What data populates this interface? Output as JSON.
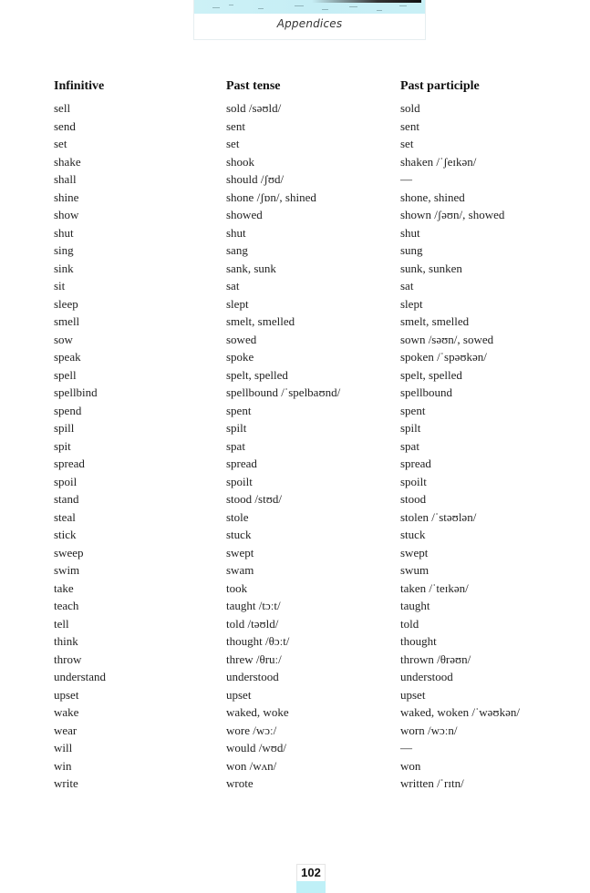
{
  "header": {
    "section_title": "Appendices"
  },
  "table": {
    "columns": [
      "Infinitive",
      "Past tense",
      "Past participle"
    ],
    "rows": [
      [
        "sell",
        "sold /səʊld/",
        "sold"
      ],
      [
        "send",
        "sent",
        "sent"
      ],
      [
        "set",
        "set",
        "set"
      ],
      [
        "shake",
        "shook",
        "shaken /ˈʃeɪkən/"
      ],
      [
        "shall",
        "should /ʃʊd/",
        "—"
      ],
      [
        "shine",
        "shone /ʃɒn/, shined",
        "shone, shined"
      ],
      [
        "show",
        "showed",
        "shown /ʃəʊn/, showed"
      ],
      [
        "shut",
        "shut",
        "shut"
      ],
      [
        "sing",
        "sang",
        "sung"
      ],
      [
        "sink",
        "sank, sunk",
        "sunk, sunken"
      ],
      [
        "sit",
        "sat",
        "sat"
      ],
      [
        "sleep",
        "slept",
        "slept"
      ],
      [
        "smell",
        "smelt, smelled",
        "smelt, smelled"
      ],
      [
        "sow",
        "sowed",
        "sown /səʊn/, sowed"
      ],
      [
        "speak",
        "spoke",
        "spoken /ˈspəʊkən/"
      ],
      [
        "spell",
        "spelt, spelled",
        "spelt, spelled"
      ],
      [
        "spellbind",
        "spellbound /ˈspelbaʊnd/",
        "spellbound"
      ],
      [
        "spend",
        "spent",
        "spent"
      ],
      [
        "spill",
        "spilt",
        "spilt"
      ],
      [
        "spit",
        "spat",
        "spat"
      ],
      [
        "spread",
        "spread",
        "spread"
      ],
      [
        "spoil",
        "spoilt",
        "spoilt"
      ],
      [
        "stand",
        "stood /stʊd/",
        "stood"
      ],
      [
        "steal",
        "stole",
        "stolen /ˈstəʊlən/"
      ],
      [
        "stick",
        "stuck",
        "stuck"
      ],
      [
        "sweep",
        "swept",
        "swept"
      ],
      [
        "swim",
        "swam",
        "swum"
      ],
      [
        "take",
        "took",
        "taken /ˈteɪkən/"
      ],
      [
        "teach",
        "taught /tɔːt/",
        "taught"
      ],
      [
        "tell",
        "told /təʊld/",
        "told"
      ],
      [
        "think",
        "thought /θɔːt/",
        "thought"
      ],
      [
        "throw",
        "threw /θruː/",
        "thrown /θrəʊn/"
      ],
      [
        "understand",
        "understood",
        "understood"
      ],
      [
        "upset",
        "upset",
        "upset"
      ],
      [
        "wake",
        "waked, woke",
        "waked, woken /ˈwəʊkən/"
      ],
      [
        "wear",
        "wore /wɔː/",
        "worn /wɔːn/"
      ],
      [
        "will",
        "would /wʊd/",
        "—"
      ],
      [
        "win",
        "won /wʌn/",
        "won"
      ],
      [
        "write",
        "wrote",
        "written /ˈrɪtn/"
      ]
    ]
  },
  "footer": {
    "page_number": "102"
  },
  "colors": {
    "banner_cyan": "#c6eef5",
    "page_number_cyan": "#bff0f7"
  }
}
